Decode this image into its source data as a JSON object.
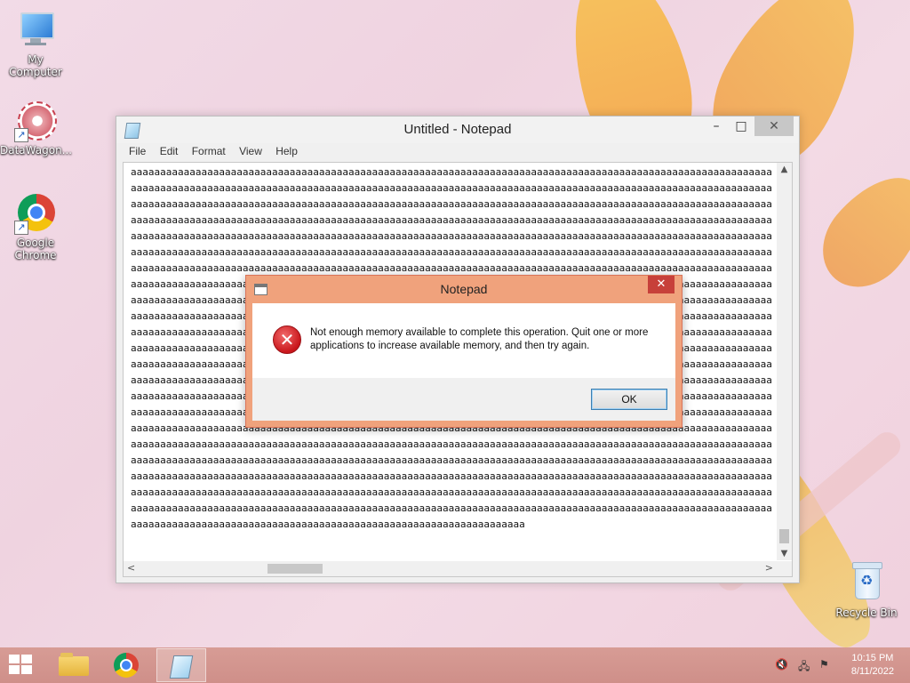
{
  "desktop": {
    "icons": [
      {
        "label": "My Computer"
      },
      {
        "label": "DataWagon..."
      },
      {
        "label": "Google Chrome"
      },
      {
        "label": "Recycle Bin"
      }
    ]
  },
  "notepad": {
    "title": "Untitled - Notepad",
    "minimize": "–",
    "maximize": "□",
    "close": "✕",
    "menu": [
      "File",
      "Edit",
      "Format",
      "View",
      "Help"
    ],
    "text": "aaaaaaaaaaaaaaaaaaaaaaaaaaaaaaaaaaaaaaaaaaaaaaaaaaaaaaaaaaaaaaaaaaaaaaaaaaaaaaaaaaaaaaaaaaaaaaaaaaaaaaaaaaaaaaaa\naaaaaaaaaaaaaaaaaaaaaaaaaaaaaaaaaaaaaaaaaaaaaaaaaaaaaaaaaaaaaaaaaaaaaaaaaaaaaaaaaaaaaaaaaaaaaaaaaaaaaaaaaaaaaaaaaa\naaaaaaaaaaaaaaaaaaaaaaaaaaaaaaaaaaaaaaaaaaaaaaaaaaaaaaaaaaaaaaaaaaaaaaaaaaaaaaaaaaaaaaaaaaaaaaaaaaaaaaaaaaaaaaaaa\naaaaaaaaaaaaaaaaaaaaaaaaaaaaaaaaaaaaaaaaaaaaaaaaaaaaaaaaaaaaaaaaaaaaaaaaaaaaaaaaaaaaaaaaaaaaaaaaaaaaaaaaaaaaaaaaa\naaaaaaaaaaaaaaaaaaaaaaaaaaaaaaaaaaaaaaaaaaaaaaaaaaaaaaaaaaaaaaaaaaaaaaaaaaaaaaaaaaaaaaaaaaaaaaaaaaaaaaaaaaaaaaaaa\naaaaaaaaaaaaaaaaaaaaaaaaaaaaaaaaaaaaaaaaaaaaaaaaaaaaaaaaaaaaaaaaaaaaaaaaaaaaaaaaaaaaaaaaaaaaaaaaaaaaaaaaaaaaaaaaa\naaaaaaaaaaaaaaaaaaaaaaaaaaaaaaaaaaaaaaaaaaaaaaaaaaaaaaaaaaaaaaaaaaaaaaaaaaaaaaaaaaaaaaaaaaaaaaaaaaaaaaaaaaaaaaaaa\naaaaaaaaaaaaaaaaaaaaaaaaaaaaaaaaaaaaaaaaaaaaaaaaaaaaaaaaaaaaaaaaaaaaaaaaaaaaaaaaaaaaaaaaaaaaaaaaaaaaaaaaaaaaaaaaa\naaaaaaaaaaaaaaaaaaaaaaaaaaaaaaaaaaaaaaaaaaaaaaaaaaaaaaaaaaaaaaaaaaaaaaaaaaaaaaaaaaaaaaaaaaaaaaaaaaaaaaaaaaaaaaaaa\naaaaaaaaaaaaaaaaaaaaaaaaaaaaaaaaaaaaaaaaaaaaaaaaaaaaaaaaaaaaaaaaaaaaaaaaaaaaaaaaaaaaaaaaaaaaaaaaaaaaaaaaaaaaaaaaa\naaaaaaaaaaaaaaaaaaaaaaaaaaaaaaaaaaaaaaaaaaaaaaaaaaaaaaaaaaaaaaaaaaaaaaaaaaaaaaaaaaaaaaaaaaaaaaaaaaaaaaaaaaaaaaaaa\naaaaaaaaaaaaaaaaaaaaaaaaaaaaaaaaaaaaaaaaaaaaaaaaaaaaaaaaaaaaaaaaaaaaaaaaaaaaaaaaaaaaaaaaaaaaaaaaaaaaaaaaaaaaaaaaa\naaaaaaaaaaaaaaaaaaaaaaaaaaaaaaaaaaaaaaaaaaaaaaaaaaaaaaaaaaaaaaaaaaaaaaaaaaaaaaaaaaaaaaaaaaaaaaaaaaaaaaaaaaaaaaaaa\naaaaaaaaaaaaaaaaaaaaaaaaaaaaaaaaaaaaaaaaaaaaaaaaaaaaaaaaaaaaaaaaaaaaaaaaaaaaaaaaaaaaaaaaaaaaaaaaaaaaaaaaaaaaaaaaa\naaaaaaaaaaaaaaaaaaaaaaaaaaaaaaaaaaaaaaaaaaaaaaaaaaaaaaaaaaaaaaaaaaaaaaaaaaaaaaaaaaaaaaaaaaaaaaaaaaaaaaaaaaaaaaaaa\naaaaaaaaaaaaaaaaaaaaaaaaaaaaaaaaaaaaaaaaaaaaaaaaaaaaaaaaaaaaaaaaaaaaaaaaaaaaaaaaaaaaaaaaaaaaaaaaaaaaaaaaaaaaaaaaa\naaaaaaaaaaaaaaaaaaaaaaaaaaaaaaaaaaaaaaaaaaaaaaaaaaaaaaaaaaaaaaaaaaaaaaaaaaaaaaaaaaaaaaaaaaaaaaaaaaaaaaaaaaaaaaaaa\naaaaaaaaaaaaaaaaaaaaaaaaaaaaaaaaaaaaaaaaaaaaaaaaaaaaaaaaaaaaaaaaaaaaaaaaaaaaaaaaaaaaaaaaaaaaaaaaaaaaaaaaaaaaaaaaa\naaaaaaaaaaaaaaaaaaaaaaaaaaaaaaaaaaaaaaaaaaaaaaaaaaaaaaaaaaaaaaaaaaaaaaaaaaaaaaaaaaaaaaaaaaaaaaaaaaaaaaaaaaaaaaaaa\naaaaaaaaaaaaaaaaaaaaaaaaaaaaaaaaaaaaaaaaaaaaaaaaaaaaaaaaaaaaaaaaaaaaaaaaaaaaaaaaaaaaaaaaaaaaaaaaaaaaaaaaaaaaaaaaa\naaaaaaaaaaaaaaaaaaaaaaaaaaaaaaaaaaaaaaaaaaaaaaaaaaaaaaaaaaaaaaaaaaaaaaaaaaaaaaaaaaaaaaaaaaaaaaaaaaaaaaaaaaaaaaaaa\naaaaaaaaaaaaaaaaaaaaaaaaaaaaaaaaaaaaaaaaaaaaaaaaaaaaaaaaaaaaaaaaaaaaaaaaaaaaaaaaaaaaaaaaaaaaaaaaaaaaaaaaaaaaaaaaa\naaaaaaaaaaaaaaaaaaaaaaaaaaaaaaaaaaaaaaaaaaaaaaaaaaaaaaaaaaaaaaaaaaa"
  },
  "dialog": {
    "title": "Notepad",
    "close": "✕",
    "message": "Not enough memory available to complete this operation. Quit one or more applications to increase available memory, and then try again.",
    "ok_label": "OK"
  },
  "taskbar": {
    "items": [
      "File Explorer",
      "Google Chrome",
      "Notepad"
    ],
    "time": "10:15 PM",
    "date": "8/11/2022"
  },
  "icons": {
    "error": "error-icon",
    "accent": "#f0a27c"
  }
}
